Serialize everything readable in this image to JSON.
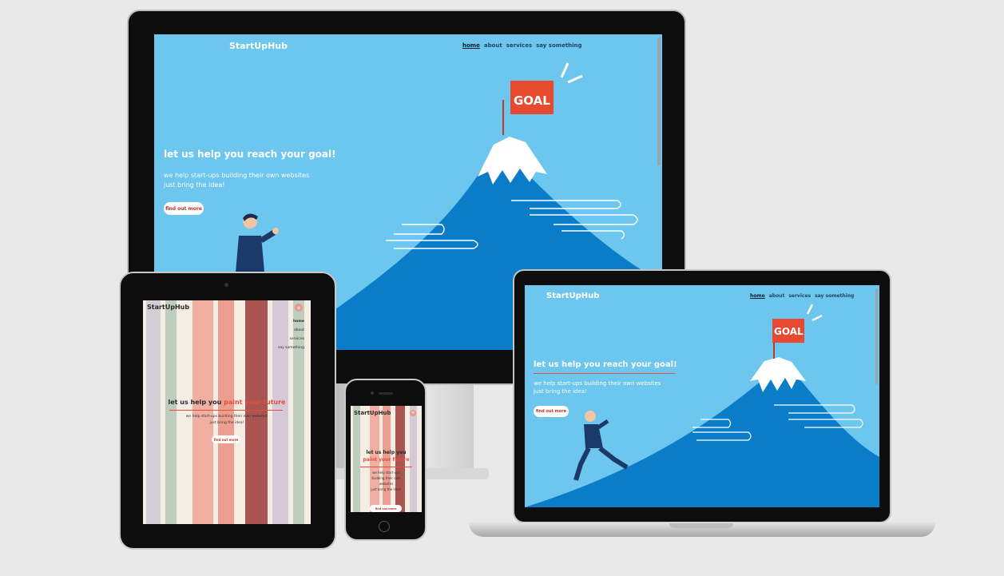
{
  "monitor_site": {
    "brand": "StartUpHub",
    "nav": [
      "home",
      "about",
      "services",
      "say something"
    ],
    "heading": "let us help you reach your goal!",
    "sub_line1": "we help start-ups building their own websites",
    "sub_line2": "just bring the idea!",
    "cta": "find out more",
    "flag": "GOAL"
  },
  "laptop_site": {
    "brand": "StartUpHub",
    "nav": [
      "home",
      "about",
      "services",
      "say something"
    ],
    "heading": "let us help you reach your goal!",
    "sub_line1": "we help start-ups building their own websites",
    "sub_line2": "just bring the idea!",
    "cta": "find out more",
    "flag": "GOAL"
  },
  "tablet_site": {
    "brand": "StartUpHub",
    "menu": [
      "home",
      "about",
      "services",
      "say something"
    ],
    "heading_plain": "let us help you",
    "heading_accent": "paint your future",
    "sub_line1": "we help start-ups building their own websites",
    "sub_line2": "just bring the idea!",
    "cta": "find out more"
  },
  "phone_site": {
    "brand": "StartUpHub",
    "heading_plain": "let us help you",
    "heading_accent": "paint your future",
    "sub_line1": "we help start-ups",
    "sub_line2": "building their own",
    "sub_line3": "websites",
    "sub_line4": "just bring the idea!",
    "cta": "find out more"
  },
  "colors": {
    "sky": "#6cc6ee",
    "mountain": "#0a7cc8",
    "flag": "#e84a2f",
    "cta_text": "#c0352b",
    "accent": "#e0503f"
  }
}
